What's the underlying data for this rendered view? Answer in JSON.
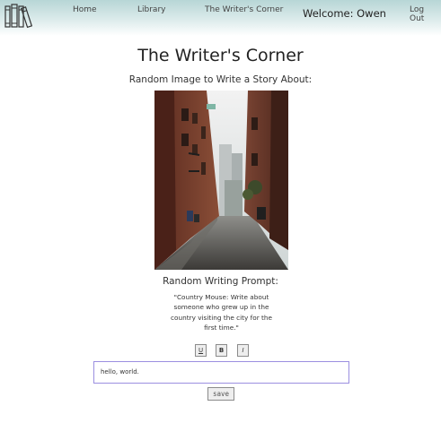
{
  "nav": {
    "home": "Home",
    "library": "Library",
    "writers_corner": "The Writer's Corner",
    "welcome": "Welcome: Owen",
    "logout": "Log Out"
  },
  "page": {
    "title": "The Writer's Corner",
    "subtitle": "Random Image to Write a Story About:",
    "image": "alley-photo",
    "prompt_heading": "Random Writing Prompt:",
    "prompt_text": "\"Country Mouse: Write about someone who grew up in the country visiting the city for the first time.\""
  },
  "toolbar": {
    "underline": "U",
    "bold": "B",
    "italic": "I"
  },
  "editor": {
    "value": "hello, world."
  },
  "save_label": "save",
  "colors": {
    "header_top": "#b7d6d6",
    "editor_border": "#9b8fe0"
  }
}
